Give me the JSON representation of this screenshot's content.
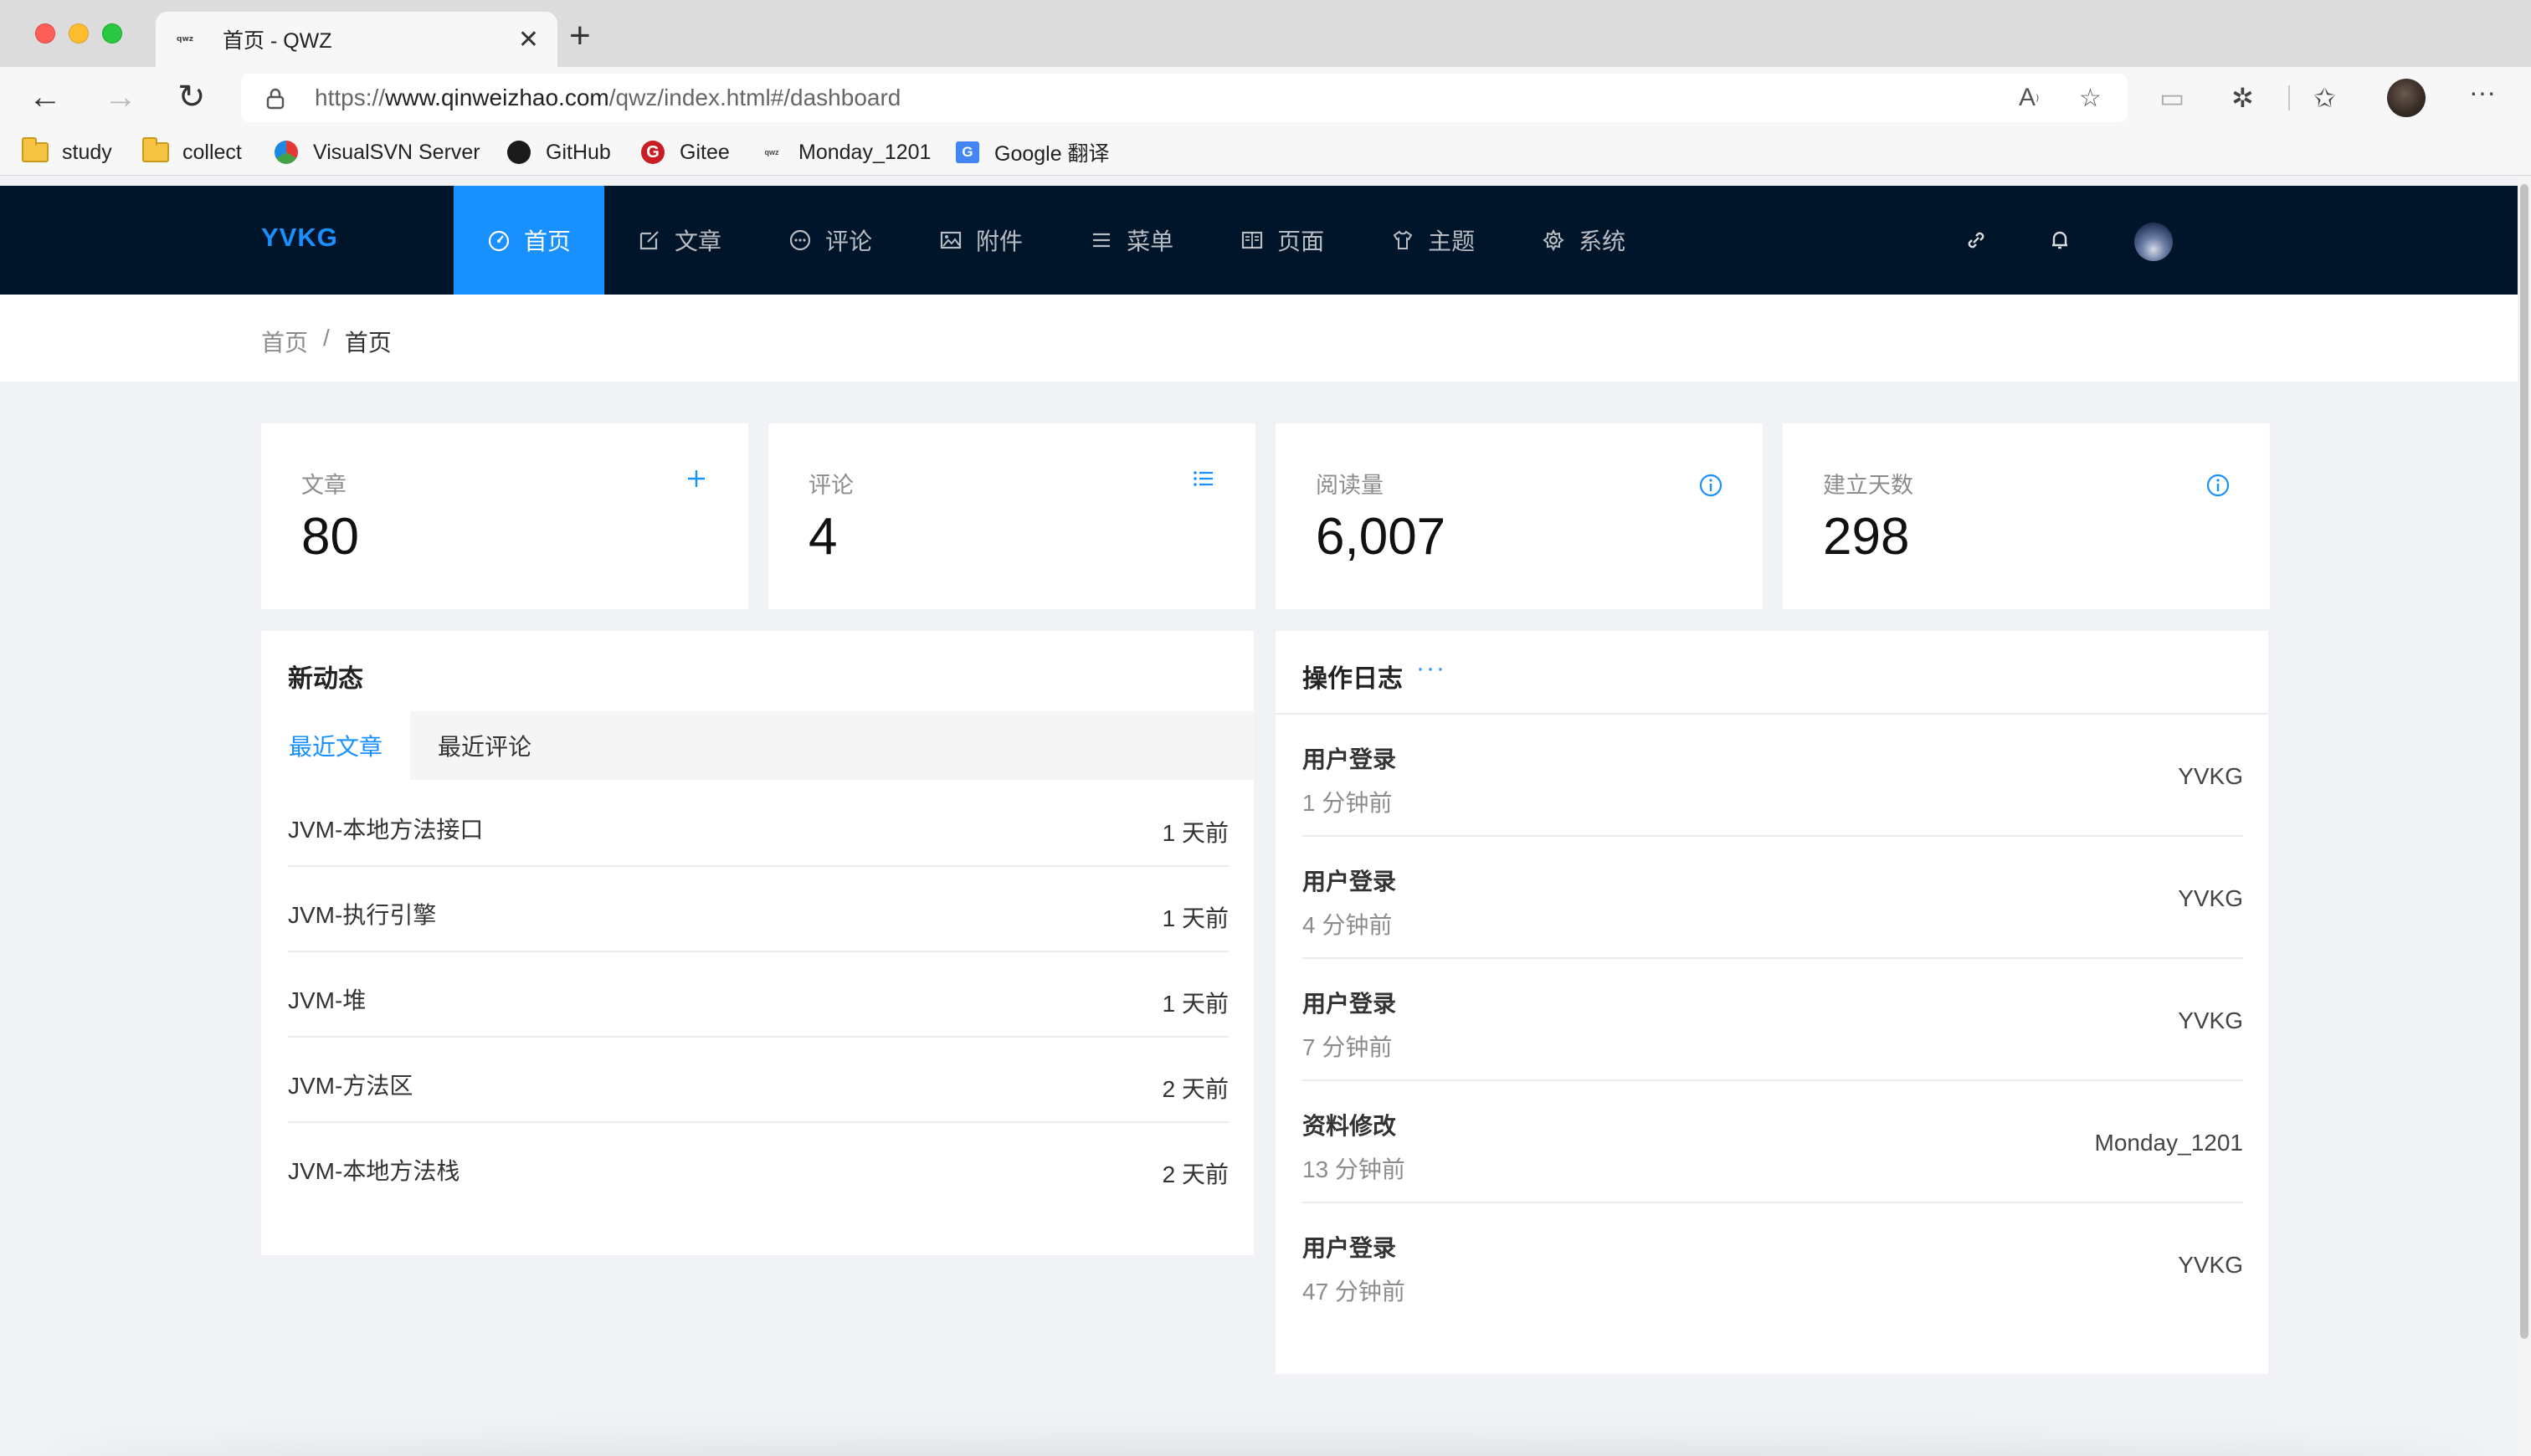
{
  "browser": {
    "tab_title": "首页 - QWZ",
    "tab_favicon_text": "qwz",
    "url_prefix": "https://",
    "url_host": "www.qinweizhao.com",
    "url_path": "/qwz/index.html#/dashboard",
    "bookmarks": [
      {
        "label": "study",
        "icon": "folder-icon"
      },
      {
        "label": "collect",
        "icon": "folder-icon"
      },
      {
        "label": "VisualSVN Server",
        "icon": "visualsvn-icon"
      },
      {
        "label": "GitHub",
        "icon": "github-icon"
      },
      {
        "label": "Gitee",
        "icon": "gitee-icon"
      },
      {
        "label": "Monday_1201",
        "icon": "qwz-favicon-icon"
      },
      {
        "label": "Google 翻译",
        "icon": "google-translate-icon"
      }
    ]
  },
  "header": {
    "brand": "YVKG",
    "menu": [
      {
        "label": "首页",
        "icon": "dashboard-icon",
        "active": true
      },
      {
        "label": "文章",
        "icon": "edit-icon",
        "active": false
      },
      {
        "label": "评论",
        "icon": "comment-icon",
        "active": false
      },
      {
        "label": "附件",
        "icon": "picture-icon",
        "active": false
      },
      {
        "label": "菜单",
        "icon": "menu-icon",
        "active": false
      },
      {
        "label": "页面",
        "icon": "book-icon",
        "active": false
      },
      {
        "label": "主题",
        "icon": "skin-icon",
        "active": false
      },
      {
        "label": "系统",
        "icon": "setting-icon",
        "active": false
      }
    ]
  },
  "breadcrumb": {
    "root": "首页",
    "separator": "/",
    "current": "首页"
  },
  "stats": [
    {
      "title": "文章",
      "value": "80",
      "icon": "plus-icon"
    },
    {
      "title": "评论",
      "value": "4",
      "icon": "list-icon"
    },
    {
      "title": "阅读量",
      "value": "6,007",
      "icon": "info-icon"
    },
    {
      "title": "建立天数",
      "value": "298",
      "icon": "info-icon"
    }
  ],
  "activity": {
    "title": "新动态",
    "tabs": [
      "最近文章",
      "最近评论"
    ],
    "posts": [
      {
        "title": "JVM-本地方法接口",
        "time": "1 天前"
      },
      {
        "title": "JVM-执行引擎",
        "time": "1 天前"
      },
      {
        "title": "JVM-堆",
        "time": "1 天前"
      },
      {
        "title": "JVM-方法区",
        "time": "2 天前"
      },
      {
        "title": "JVM-本地方法栈",
        "time": "2 天前"
      }
    ]
  },
  "logs": {
    "title": "操作日志",
    "more": "···",
    "items": [
      {
        "action": "用户登录",
        "time": "1 分钟前",
        "user": "YVKG"
      },
      {
        "action": "用户登录",
        "time": "4 分钟前",
        "user": "YVKG"
      },
      {
        "action": "用户登录",
        "time": "7 分钟前",
        "user": "YVKG"
      },
      {
        "action": "资料修改",
        "time": "13 分钟前",
        "user": "Monday_1201"
      },
      {
        "action": "用户登录",
        "time": "47 分钟前",
        "user": "YVKG"
      }
    ]
  },
  "colors": {
    "primary": "#1890ff",
    "header_bg": "#001529",
    "page_bg": "#f0f2f5"
  }
}
